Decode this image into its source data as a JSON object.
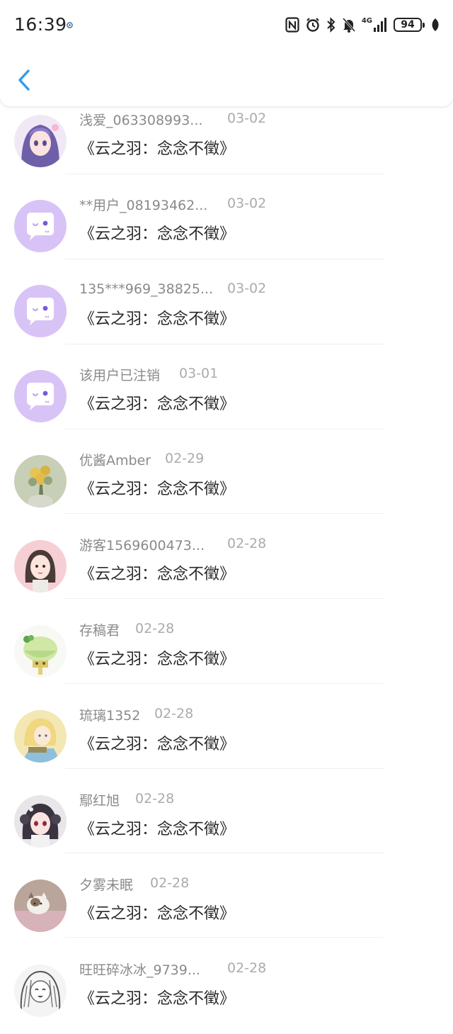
{
  "status_bar": {
    "time": "16:39",
    "network": "4G",
    "battery": "94",
    "icons": [
      "nfc-icon",
      "alarm-icon",
      "bluetooth-icon",
      "mute-icon",
      "signal-icon",
      "battery-icon",
      "leaf-icon"
    ]
  },
  "header": {
    "back_icon": "chevron-left-icon"
  },
  "colors": {
    "accent": "#2f9bf0",
    "placeholder_avatar": "#d8c3f6"
  },
  "items": [
    {
      "user": "浅爱_063308993...",
      "date": "03-02",
      "title": "《云之羽：念念不徵》",
      "avatar": "anime-girl-purple"
    },
    {
      "user": "**用户_08193462...",
      "date": "03-02",
      "title": "《云之羽：念念不徵》",
      "avatar": "default-chat-bubble"
    },
    {
      "user": "135***969_38825...",
      "date": "03-02",
      "title": "《云之羽：念念不徵》",
      "avatar": "default-chat-bubble"
    },
    {
      "user": "该用户已注销",
      "date": "03-01",
      "title": "《云之羽：念念不徵》",
      "avatar": "default-chat-bubble"
    },
    {
      "user": "优酱Amber",
      "date": "02-29",
      "title": "《云之羽：念念不徵》",
      "avatar": "flower-bouquet"
    },
    {
      "user": "游客1569600473...",
      "date": "02-28",
      "title": "《云之羽：念念不徵》",
      "avatar": "cartoon-girl"
    },
    {
      "user": "存稿君",
      "date": "02-28",
      "title": "《云之羽：念念不徵》",
      "avatar": "green-dessert"
    },
    {
      "user": "琉璃1352",
      "date": "02-28",
      "title": "《云之羽：念念不徵》",
      "avatar": "anime-blond"
    },
    {
      "user": "鄢红旭",
      "date": "02-28",
      "title": "《云之羽：念念不徵》",
      "avatar": "anime-girl-headphones"
    },
    {
      "user": "夕雾未眠",
      "date": "02-28",
      "title": "《云之羽：念念不徵》",
      "avatar": "cat-photo"
    },
    {
      "user": "旺旺碎冰冰_9739...",
      "date": "02-28",
      "title": "《云之羽：念念不徵》",
      "avatar": "sketch-girl"
    }
  ]
}
